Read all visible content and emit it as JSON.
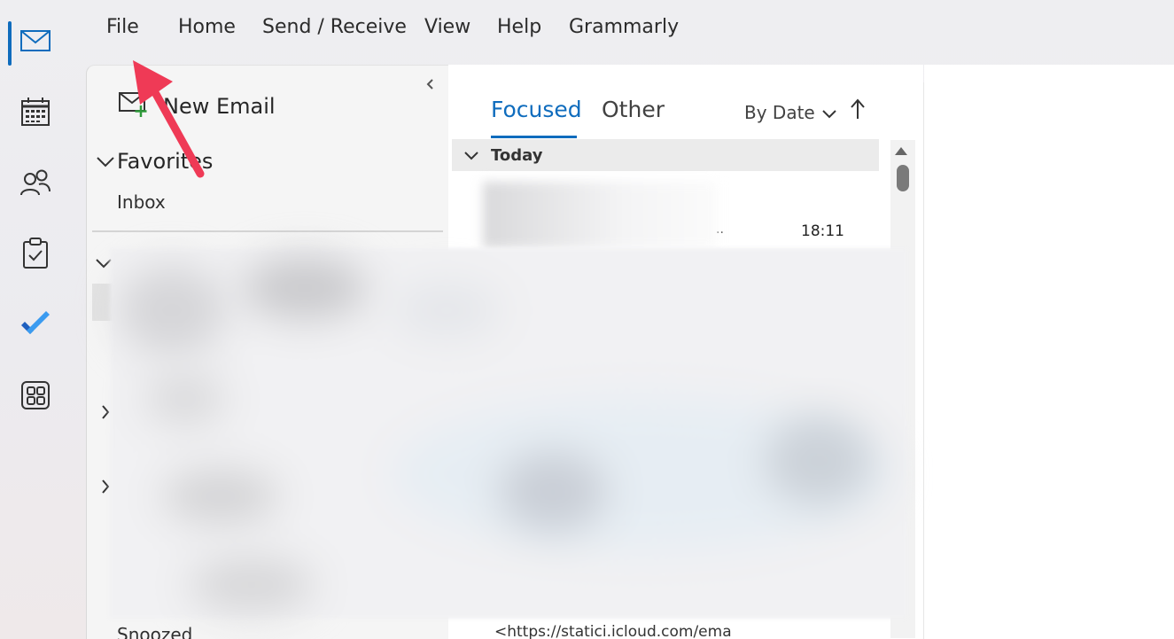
{
  "menu": {
    "file": "File",
    "home": "Home",
    "send_receive": "Send / Receive",
    "view": "View",
    "help": "Help",
    "grammarly": "Grammarly"
  },
  "folder_pane": {
    "new_email": "New Email",
    "favorites": "Favorites",
    "inbox": "Inbox",
    "snoozed": "Snoozed"
  },
  "message_list": {
    "tabs": [
      "Focused",
      "Other"
    ],
    "sort_label": "By Date",
    "group_today": "Today",
    "first_message_time": "18:11",
    "first_message_ellipsis": "..",
    "preview_text": "<https://statici.icloud.com/ema"
  },
  "colors": {
    "accent": "#0f6cbd",
    "annotation_arrow": "#ef3a56",
    "todo_dark": "#1f5fbf",
    "todo_light": "#3b9bf0",
    "new_email_plus": "#2e9a3a"
  },
  "icons": {
    "rail": [
      "mail-icon",
      "calendar-icon",
      "people-icon",
      "tasks-icon",
      "todo-icon",
      "apps-icon"
    ]
  }
}
